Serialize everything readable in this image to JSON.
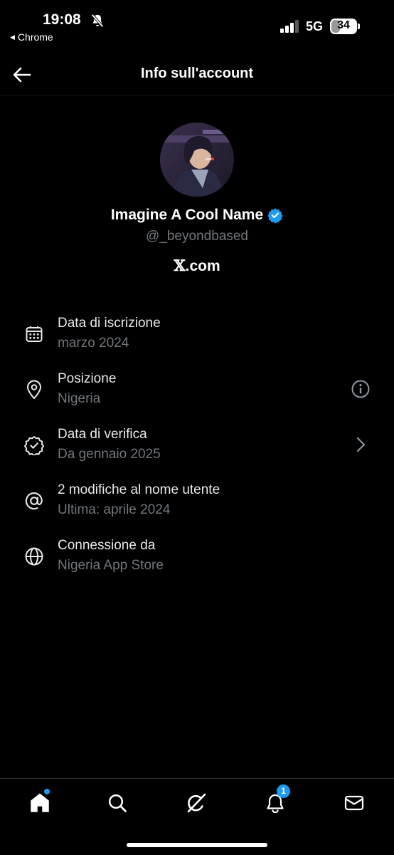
{
  "status_bar": {
    "time": "19:08",
    "back_app": "Chrome",
    "network": "5G",
    "battery": "34",
    "battery_level": 0.34
  },
  "header": {
    "title": "Info sull'account"
  },
  "profile": {
    "name": "Imagine A Cool Name",
    "handle": "@_beyondbased",
    "site_logo": "𝕏",
    "site_suffix": ".com"
  },
  "info": [
    {
      "icon": "calendar-icon",
      "label": "Data di iscrizione",
      "value": "marzo 2024"
    },
    {
      "icon": "location-pin-icon",
      "label": "Posizione",
      "value": "Nigeria",
      "action_icon": "info-circle-icon"
    },
    {
      "icon": "verified-badge-outline-icon",
      "label": "Data di verifica",
      "value": "Da gennaio 2025",
      "action_icon": "chevron-right-icon"
    },
    {
      "icon": "at-sign-icon",
      "label": "2 modifiche al nome utente",
      "value": "Ultima: aprile 2024"
    },
    {
      "icon": "globe-icon",
      "label": "Connessione da",
      "value": "Nigeria App Store"
    }
  ],
  "bottom_nav": {
    "items": [
      {
        "icon": "home-icon",
        "has_dot": true
      },
      {
        "icon": "search-icon"
      },
      {
        "icon": "grok-icon"
      },
      {
        "icon": "bell-icon",
        "badge": "1"
      },
      {
        "icon": "mail-icon"
      }
    ]
  },
  "colors": {
    "background": "#000000",
    "primary_text": "#e7e9ea",
    "secondary_text": "#71767b",
    "accent": "#1d9bf0"
  }
}
